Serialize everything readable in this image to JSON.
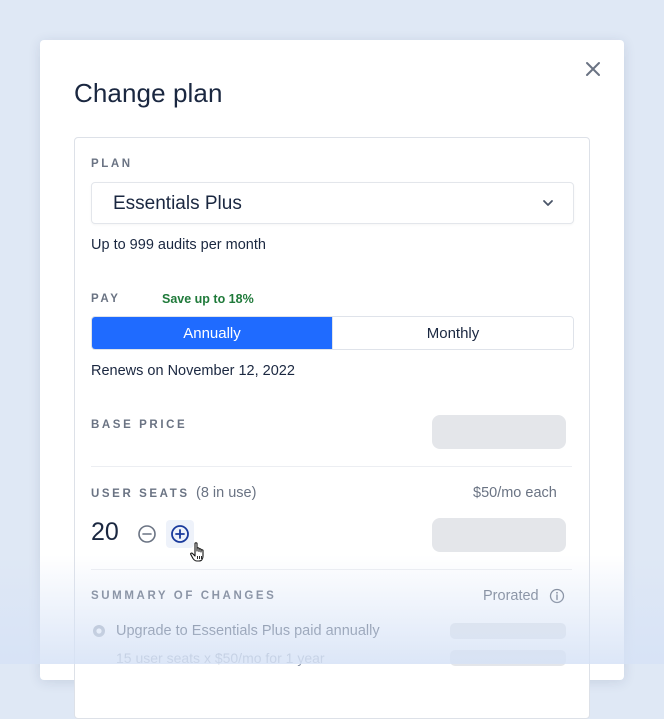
{
  "modal": {
    "title": "Change plan"
  },
  "plan": {
    "label": "PLAN",
    "selected": "Essentials Plus",
    "description": "Up to 999 audits per month"
  },
  "pay": {
    "label": "PAY",
    "savings": "Save up to 18%",
    "options": [
      "Annually",
      "Monthly"
    ],
    "selected": "Annually",
    "renewal": "Renews on November 12, 2022"
  },
  "base_price": {
    "label": "BASE PRICE"
  },
  "user_seats": {
    "label": "USER SEATS",
    "in_use": "(8 in use)",
    "price": "$50/mo each",
    "count": "20"
  },
  "summary": {
    "label": "SUMMARY OF CHANGES",
    "prorated": "Prorated",
    "items": [
      "Upgrade to Essentials Plus paid annually",
      "15 user seats x $50/mo for 1 year"
    ]
  },
  "colors": {
    "accent": "#1f6bff",
    "savings": "#1f7a3a",
    "background": "#dfe8f5",
    "skeleton": "#e4e6ea"
  },
  "icons": [
    "close-icon",
    "chevron-down-icon",
    "minus-circle-icon",
    "plus-circle-icon",
    "hand-cursor-icon",
    "info-icon",
    "status-dot-icon"
  ]
}
